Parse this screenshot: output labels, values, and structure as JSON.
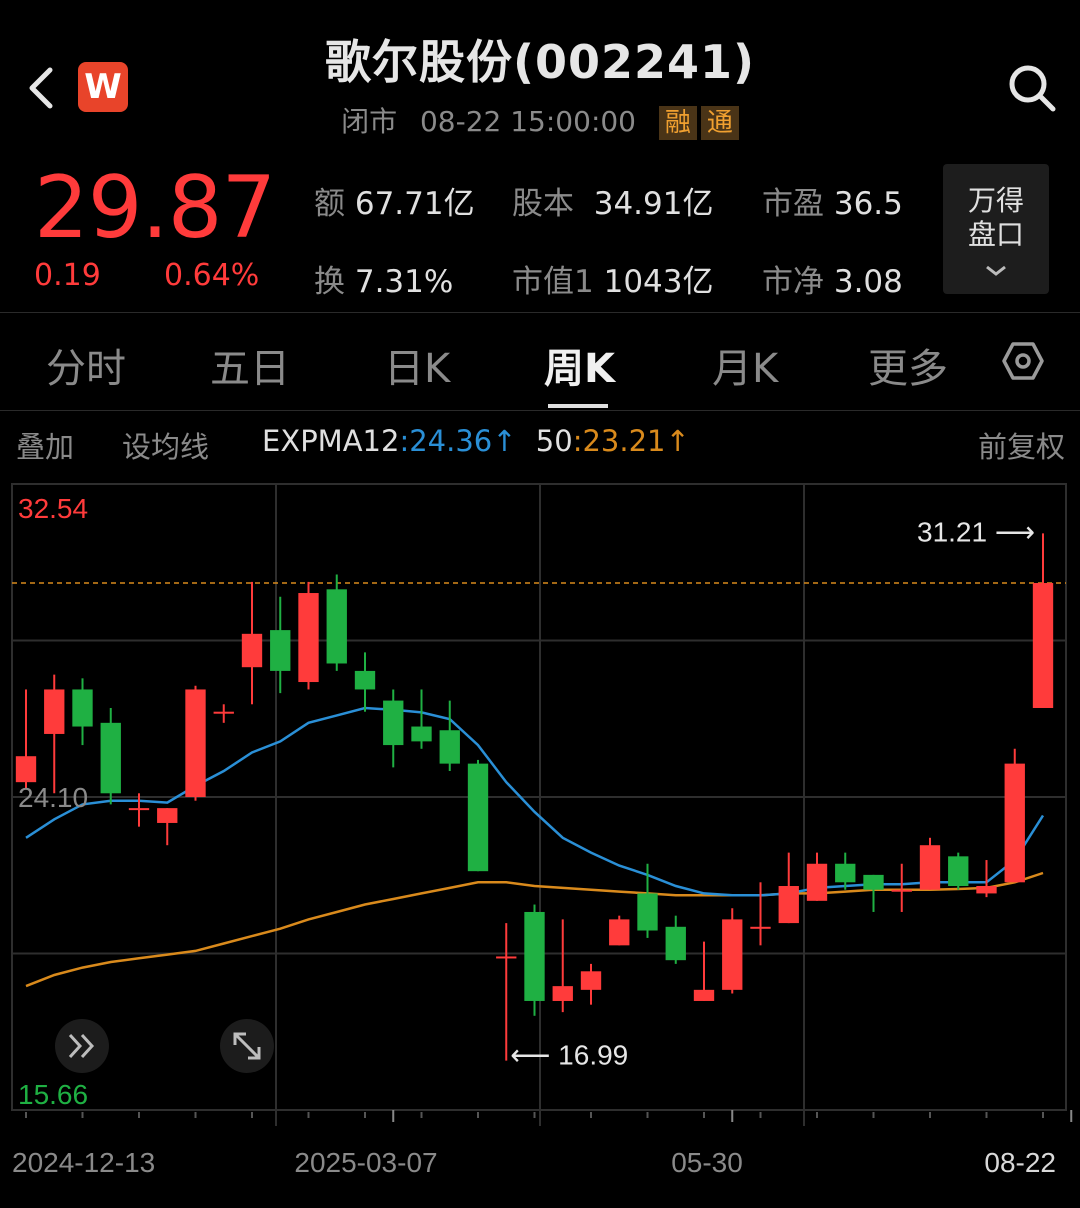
{
  "header": {
    "title": "歌尔股份(002241)",
    "status": "闭市",
    "datetime": "08-22 15:00:00",
    "tags": [
      "融",
      "通"
    ],
    "logo_text": "W"
  },
  "quote": {
    "price": "29.87",
    "change": "0.19",
    "change_pct": "0.64%",
    "stats": [
      {
        "label": "额",
        "value": "67.71亿"
      },
      {
        "label": "股本",
        "value": "34.91亿"
      },
      {
        "label": "市盈",
        "value": "36.5"
      },
      {
        "label": "换",
        "value": "7.31%"
      },
      {
        "label": "市值1",
        "value": "1043亿"
      },
      {
        "label": "市净",
        "value": "3.08"
      }
    ],
    "side_button": [
      "万得",
      "盘口"
    ]
  },
  "tabs": [
    {
      "label": "分时",
      "active": false
    },
    {
      "label": "五日",
      "active": false
    },
    {
      "label": "日K",
      "active": false
    },
    {
      "label": "周K",
      "active": true
    },
    {
      "label": "月K",
      "active": false
    },
    {
      "label": "更多",
      "active": false
    }
  ],
  "indicators": {
    "overlay": "叠加",
    "set_ma": "设均线",
    "ema_name": "EXPMA12",
    "ema12_value": "24.36",
    "ema50_name": "50",
    "ema50_value": "23.21",
    "arrow": "↑",
    "adjust": "前复权"
  },
  "colors": {
    "up": "#ff3b3b",
    "down": "#1fb043",
    "ema12": "#2a8fd6",
    "ema50": "#d98a1c",
    "ref_line": "#d98a1c"
  },
  "chart_data": {
    "type": "candlestick",
    "y_top_label": "32.54",
    "y_mid_label": "24.10",
    "y_bottom_label": "15.66",
    "ylim": [
      15.66,
      32.54
    ],
    "reference_line": 29.87,
    "x_labels": [
      "2024-12-13",
      "2025-03-07",
      "05-30",
      "08-22"
    ],
    "annotations": [
      {
        "text": "31.21",
        "value": 31.21,
        "direction": "right"
      },
      {
        "text": "16.99",
        "value": 16.99,
        "direction": "left"
      }
    ],
    "candles": [
      {
        "o": 24.5,
        "c": 25.2,
        "h": 27.0,
        "l": 24.3
      },
      {
        "o": 25.8,
        "c": 27.0,
        "h": 27.4,
        "l": 24.2
      },
      {
        "o": 27.0,
        "c": 26.0,
        "h": 27.3,
        "l": 25.5
      },
      {
        "o": 26.1,
        "c": 24.2,
        "h": 26.5,
        "l": 23.9
      },
      {
        "o": 23.8,
        "c": 23.8,
        "h": 24.2,
        "l": 23.3
      },
      {
        "o": 23.4,
        "c": 23.8,
        "h": 23.8,
        "l": 22.8
      },
      {
        "o": 24.1,
        "c": 27.0,
        "h": 27.1,
        "l": 24.0
      },
      {
        "o": 26.4,
        "c": 26.4,
        "h": 26.6,
        "l": 26.1
      },
      {
        "o": 27.6,
        "c": 28.5,
        "h": 29.9,
        "l": 26.6
      },
      {
        "o": 28.6,
        "c": 27.5,
        "h": 29.5,
        "l": 26.9
      },
      {
        "o": 27.2,
        "c": 29.6,
        "h": 29.9,
        "l": 27.0
      },
      {
        "o": 29.7,
        "c": 27.7,
        "h": 30.1,
        "l": 27.5
      },
      {
        "o": 27.5,
        "c": 27.0,
        "h": 28.0,
        "l": 26.4
      },
      {
        "o": 26.7,
        "c": 25.5,
        "h": 27.0,
        "l": 24.9
      },
      {
        "o": 26.0,
        "c": 25.6,
        "h": 27.0,
        "l": 25.4
      },
      {
        "o": 25.9,
        "c": 25.0,
        "h": 26.7,
        "l": 24.8
      },
      {
        "o": 25.0,
        "c": 22.1,
        "h": 25.1,
        "l": 22.1
      },
      {
        "o": 19.8,
        "c": 19.8,
        "h": 20.7,
        "l": 16.99
      },
      {
        "o": 21.0,
        "c": 18.6,
        "h": 21.2,
        "l": 18.2
      },
      {
        "o": 18.6,
        "c": 19.0,
        "h": 20.8,
        "l": 18.3
      },
      {
        "o": 18.9,
        "c": 19.4,
        "h": 19.6,
        "l": 18.5
      },
      {
        "o": 20.1,
        "c": 20.8,
        "h": 20.9,
        "l": 20.1
      },
      {
        "o": 21.5,
        "c": 20.5,
        "h": 22.3,
        "l": 20.3
      },
      {
        "o": 20.6,
        "c": 19.7,
        "h": 20.9,
        "l": 19.6
      },
      {
        "o": 18.6,
        "c": 18.9,
        "h": 20.2,
        "l": 18.6
      },
      {
        "o": 18.9,
        "c": 20.8,
        "h": 21.1,
        "l": 18.8
      },
      {
        "o": 20.6,
        "c": 20.6,
        "h": 21.8,
        "l": 20.1
      },
      {
        "o": 20.7,
        "c": 21.7,
        "h": 22.6,
        "l": 20.7
      },
      {
        "o": 21.3,
        "c": 22.3,
        "h": 22.6,
        "l": 21.3
      },
      {
        "o": 22.3,
        "c": 21.8,
        "h": 22.6,
        "l": 21.6
      },
      {
        "o": 22.0,
        "c": 21.6,
        "h": 22.0,
        "l": 21.0
      },
      {
        "o": 21.6,
        "c": 21.6,
        "h": 22.3,
        "l": 21.0
      },
      {
        "o": 21.6,
        "c": 22.8,
        "h": 23.0,
        "l": 21.6
      },
      {
        "o": 22.5,
        "c": 21.7,
        "h": 22.6,
        "l": 21.6
      },
      {
        "o": 21.5,
        "c": 21.7,
        "h": 22.4,
        "l": 21.4
      },
      {
        "o": 21.8,
        "c": 25.0,
        "h": 25.4,
        "l": 21.8
      },
      {
        "o": 26.5,
        "c": 29.87,
        "h": 31.21,
        "l": 26.5
      }
    ],
    "ema12": [
      23.0,
      23.5,
      23.9,
      24.0,
      24.0,
      23.95,
      24.4,
      24.8,
      25.3,
      25.6,
      26.1,
      26.3,
      26.5,
      26.45,
      26.38,
      26.2,
      25.5,
      24.5,
      23.7,
      23.0,
      22.6,
      22.25,
      22.0,
      21.7,
      21.5,
      21.45,
      21.45,
      21.5,
      21.65,
      21.7,
      21.75,
      21.75,
      21.8,
      21.8,
      21.8,
      22.4,
      23.6
    ],
    "ema50": [
      19.0,
      19.3,
      19.5,
      19.65,
      19.75,
      19.85,
      19.95,
      20.15,
      20.35,
      20.55,
      20.8,
      21.0,
      21.2,
      21.35,
      21.5,
      21.65,
      21.8,
      21.8,
      21.7,
      21.65,
      21.6,
      21.55,
      21.5,
      21.45,
      21.45,
      21.45,
      21.45,
      21.5,
      21.5,
      21.55,
      21.6,
      21.6,
      21.6,
      21.62,
      21.65,
      21.8,
      22.05
    ]
  }
}
